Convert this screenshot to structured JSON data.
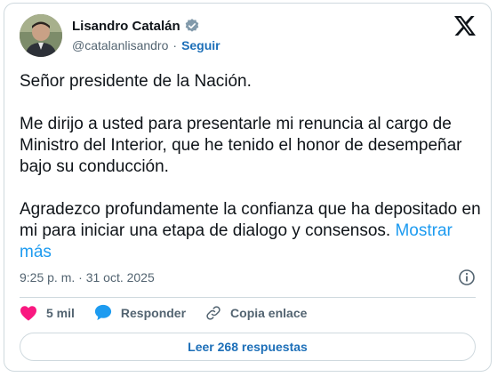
{
  "author": {
    "name": "Lisandro Catalán",
    "handle": "@catalanlisandro",
    "separator": "·",
    "follow_label": "Seguir"
  },
  "tweet": {
    "paragraphs": [
      "Señor presidente de la Nación.",
      "Me dirijo a usted para presentarle mi renuncia al cargo de Ministro del Interior, que he tenido el honor de desempeñar bajo su conducción.",
      "Agradezco profundamente la confianza que ha depositado en mi para iniciar una etapa de dialogo y consensos."
    ],
    "show_more": "Mostrar más",
    "timestamp": "9:25 p. m. · 31 oct. 2025"
  },
  "actions": {
    "likes": "5 mil",
    "reply": "Responder",
    "copy_link": "Copia enlace"
  },
  "replies_button": "Leer 268 respuestas",
  "colors": {
    "link": "#1d9bf0",
    "follow": "#1d6fb8",
    "like": "#f91880",
    "reply_icon": "#1d9bf0",
    "verified": "#829aab"
  },
  "icons": [
    "verified-badge-icon",
    "x-logo-icon",
    "info-icon",
    "heart-icon",
    "reply-bubble-icon",
    "link-icon"
  ]
}
